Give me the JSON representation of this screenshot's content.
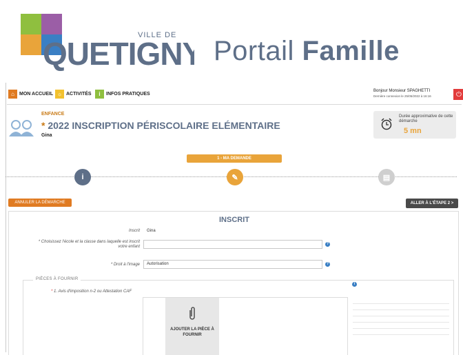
{
  "brand": {
    "logo_small": "VILLE DE",
    "logo_main": "QUETIGNY",
    "portal_prefix": "Portail",
    "portal_bold": "Famille"
  },
  "nav": {
    "items": [
      {
        "label": "MON ACCUEIL",
        "icon": "home-icon",
        "color": "#e07b22"
      },
      {
        "label": "ACTIVITÉS",
        "icon": "sun-icon",
        "color": "#f2c12e"
      },
      {
        "label": "INFOS PRATIQUES",
        "icon": "info-icon",
        "color": "#8fbf3f"
      }
    ],
    "greeting": "Bonjour Monsieur SPAGHETTI",
    "last_login": "Dernière connexion le 25/05/2022 à 16:16",
    "power_icon": "power-icon"
  },
  "page": {
    "category": "ENFANCE",
    "title_star": "*",
    "title": "2022 INSCRIPTION PÉRISCOLAIRE ELÉMENTAIRE",
    "child": "Gina"
  },
  "duration": {
    "label": "Durée approximative de cette démarche",
    "value": "5 mn"
  },
  "stepper": {
    "current_label": "1 - MA DEMANDE",
    "steps": [
      {
        "icon": "info-icon",
        "state": "done"
      },
      {
        "icon": "pencil-icon",
        "state": "current"
      },
      {
        "icon": "list-icon",
        "state": "pending"
      }
    ]
  },
  "actions": {
    "cancel": "ANNULER LA DÉMARCHE",
    "next": "ALLER À L'ÉTAPE 2 >"
  },
  "form": {
    "title": "INSCRIT",
    "inscrit_label": "Inscrit",
    "inscrit_value": "Gina",
    "school_label": "* Choisissez l'école et la classe dans laquelle est inscrit votre enfant",
    "school_value": "",
    "image_label": "* Droit à l'image",
    "image_value": "Autorisation",
    "pieces_legend": "PIÈCES À FOURNIR",
    "piece_1_star": "*",
    "piece_1_label": "1. Avis d'imposition n-2 ou Attestation CAF",
    "upload_label": "AJOUTER LA PIÈCE À FOURNIR"
  },
  "colors": {
    "accent_orange": "#e9a43a",
    "slate": "#5e6f88",
    "danger": "#e23b3b"
  }
}
